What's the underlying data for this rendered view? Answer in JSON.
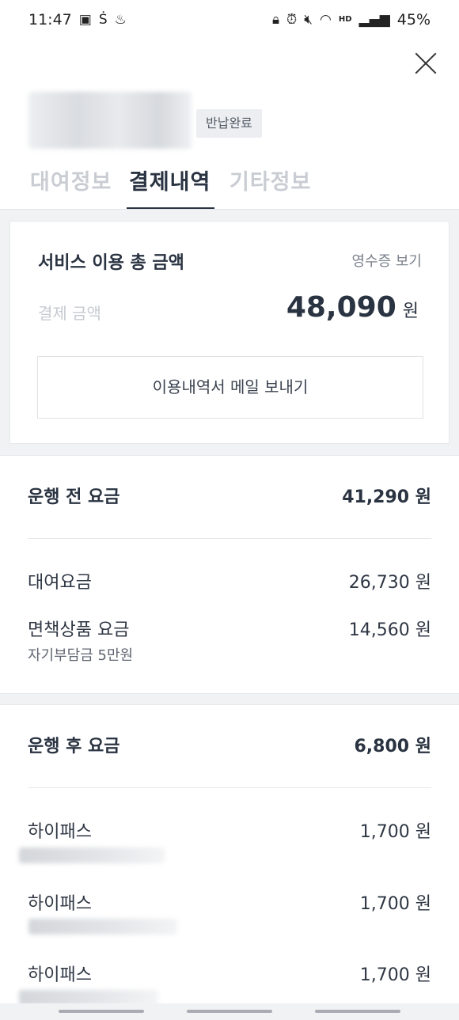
{
  "status_bar": {
    "time": "11:47",
    "battery": "45%"
  },
  "header": {
    "status_badge": "반납완료",
    "tabs": [
      {
        "label": "대여정보",
        "active": false
      },
      {
        "label": "결제내역",
        "active": true
      },
      {
        "label": "기타정보",
        "active": false
      }
    ]
  },
  "summary": {
    "title": "서비스 이용 총 금액",
    "receipt_link": "영수증 보기",
    "pay_label": "결제 금액",
    "pay_amount": "48,090",
    "pay_unit": "원",
    "email_button": "이용내역서 메일 보내기"
  },
  "pre_drive": {
    "title": "운행 전 요금",
    "total": "41,290 원",
    "items": [
      {
        "label": "대여요금",
        "value": "26,730 원"
      },
      {
        "label": "면책상품 요금",
        "value": "14,560 원",
        "sub": "자기부담금 5만원"
      }
    ]
  },
  "post_drive": {
    "title": "운행 후 요금",
    "total": "6,800 원",
    "items": [
      {
        "label": "하이패스",
        "value": "1,700 원"
      },
      {
        "label": "하이패스",
        "value": "1,700 원"
      },
      {
        "label": "하이패스",
        "value": "1,700 원"
      }
    ]
  },
  "colors": {
    "primary_text": "#2a3341",
    "muted_text": "#c9cdd3",
    "background": "#f1f2f4"
  }
}
